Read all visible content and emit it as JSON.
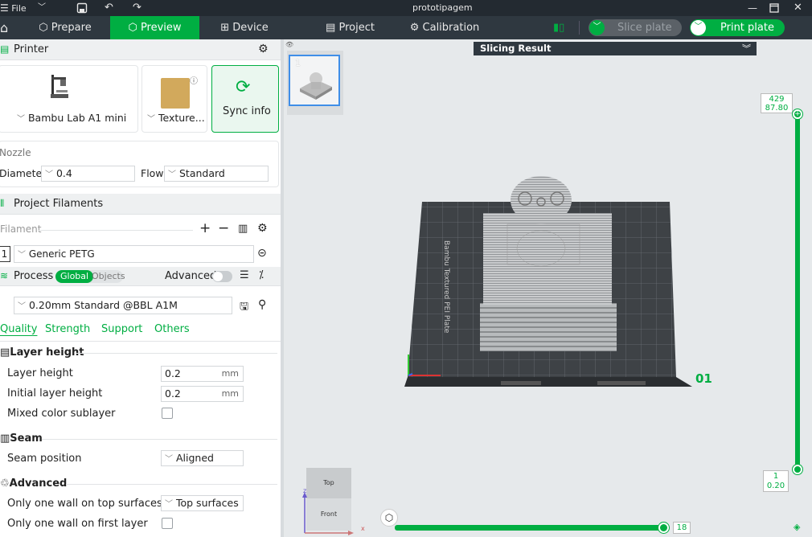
{
  "titlebar": {
    "file_label": "File",
    "project_name": "prototipagem"
  },
  "nav": {
    "prepare": "Prepare",
    "preview": "Preview",
    "device": "Device",
    "project": "Project",
    "calibration": "Calibration",
    "slice_plate": "Slice plate",
    "print_plate": "Print plate"
  },
  "printer": {
    "section_title": "Printer",
    "printer_name": "Bambu Lab A1 mini",
    "plate_type": "Texture...",
    "sync_label": "Sync info",
    "nozzle_label": "Nozzle",
    "diameter_label": "Diameter",
    "diameter_value": "0.4",
    "flow_label": "Flow",
    "flow_value": "Standard"
  },
  "filaments": {
    "section_title": "Project Filaments",
    "filament_label": "Filament",
    "items": [
      {
        "index": "1",
        "name": "Generic PETG"
      }
    ]
  },
  "process": {
    "section_title": "Process",
    "global_label": "Global",
    "objects_label": "Objects",
    "advanced_label": "Advanced",
    "preset": "0.20mm Standard @BBL A1M",
    "tabs": [
      "Quality",
      "Strength",
      "Support",
      "Others"
    ],
    "groups": {
      "layer_height": {
        "title": "Layer height",
        "layer_height_label": "Layer height",
        "layer_height_value": "0.2",
        "initial_layer_height_label": "Initial layer height",
        "initial_layer_height_value": "0.2",
        "mixed_color_label": "Mixed color sublayer",
        "unit": "mm"
      },
      "seam": {
        "title": "Seam",
        "seam_position_label": "Seam position",
        "seam_position_value": "Aligned"
      },
      "advanced": {
        "title": "Advanced",
        "one_wall_top_label": "Only one wall on top surfaces",
        "one_wall_top_value": "Top surfaces",
        "one_wall_first_label": "Only one wall on first layer"
      }
    }
  },
  "viewport": {
    "slicing_result_label": "Slicing Result",
    "plate_thumb_number": "1",
    "plate_number": "01",
    "bed_label": "Bambu Textured PEI Plate",
    "layer_top_index": "429",
    "layer_top_height": "87.80",
    "layer_bottom_index": "1",
    "layer_bottom_height": "0.20",
    "moves_value": "18",
    "viewcube_top": "Top",
    "viewcube_front": "Front",
    "axis_x": "x",
    "axis_z": "z",
    "accent": "#00ae42"
  }
}
